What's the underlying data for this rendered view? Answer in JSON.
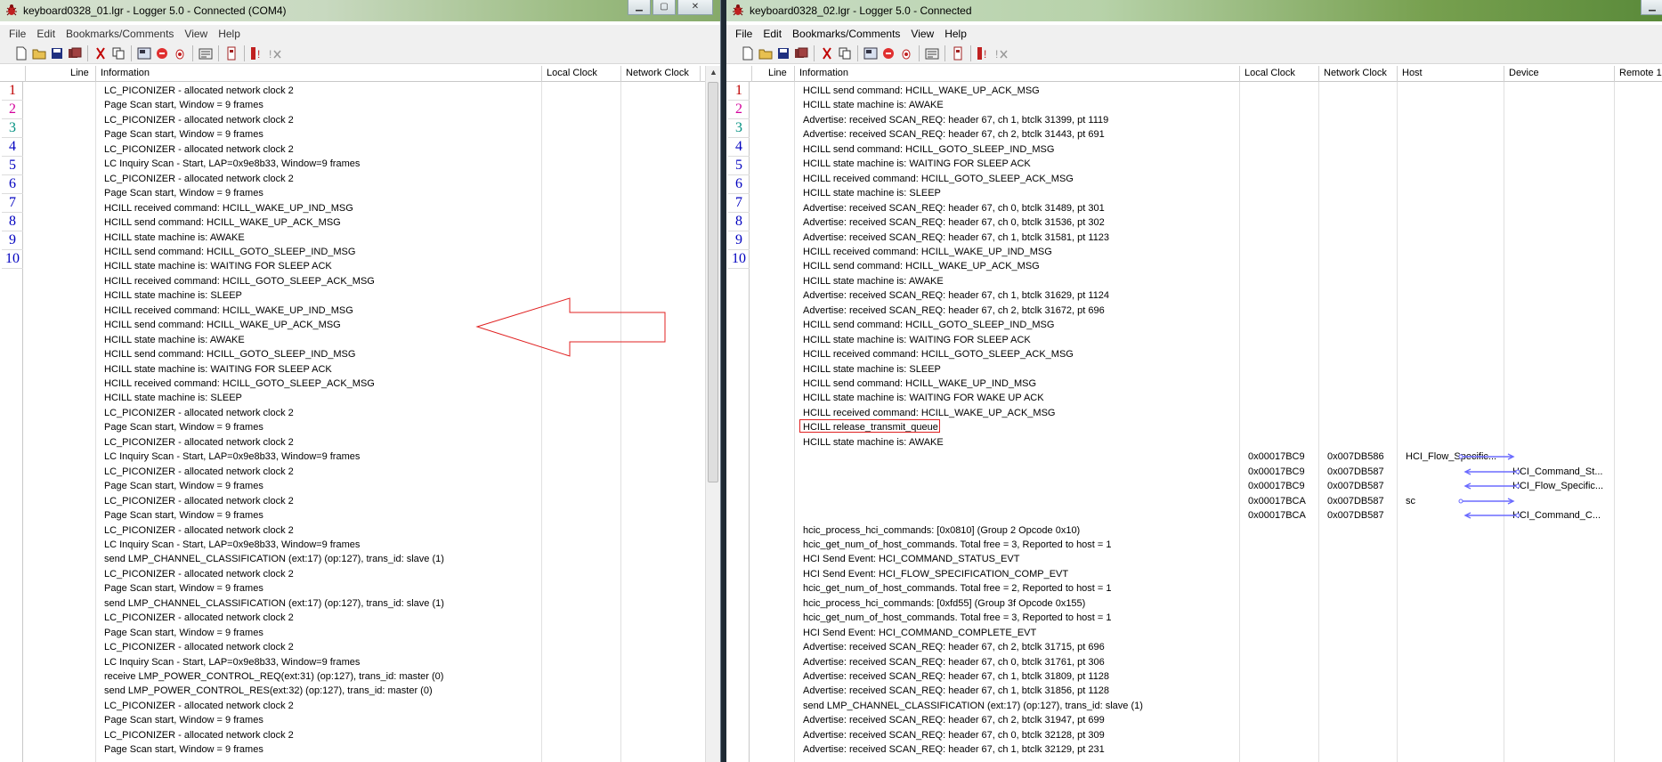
{
  "colors": {
    "bookmark_red": "#c00000",
    "bookmark_magenta": "#d4009c",
    "bookmark_teal": "#009080",
    "bookmark_blue": "#0000c0",
    "highlight": "#e02020",
    "flow_arrow": "#6b6bff"
  },
  "win1": {
    "title": "keyboard0328_01.lgr - Logger 5.0 - Connected  (COM4)",
    "menu": [
      "File",
      "Edit",
      "Bookmarks/Comments",
      "View",
      "Help"
    ],
    "columns": {
      "line": "Line",
      "info": "Information",
      "local": "Local Clock",
      "network": "Network Clock"
    },
    "bookmarks": [
      "1",
      "2",
      "3",
      "4",
      "5",
      "6",
      "7",
      "8",
      "9",
      "10"
    ],
    "rows": [
      "LC_PICONIZER - allocated network clock 2",
      "Page Scan start, Window = 9 frames",
      "LC_PICONIZER - allocated network clock 2",
      "Page Scan start, Window = 9 frames",
      "LC_PICONIZER - allocated network clock 2",
      "LC Inquiry Scan - Start, LAP=0x9e8b33, Window=9 frames",
      "LC_PICONIZER - allocated network clock 2",
      "Page Scan start, Window = 9 frames",
      "HCILL received command: HCILL_WAKE_UP_IND_MSG",
      "HCILL send command: HCILL_WAKE_UP_ACK_MSG",
      "HCILL state machine is: AWAKE",
      "HCILL send command: HCILL_GOTO_SLEEP_IND_MSG",
      "HCILL state machine is: WAITING FOR SLEEP ACK",
      "HCILL received command: HCILL_GOTO_SLEEP_ACK_MSG",
      "HCILL state machine is: SLEEP",
      "HCILL received command: HCILL_WAKE_UP_IND_MSG",
      "HCILL send command: HCILL_WAKE_UP_ACK_MSG",
      "HCILL state machine is: AWAKE",
      "HCILL send command: HCILL_GOTO_SLEEP_IND_MSG",
      "HCILL state machine is: WAITING FOR SLEEP ACK",
      "HCILL received command: HCILL_GOTO_SLEEP_ACK_MSG",
      "HCILL state machine is: SLEEP",
      "LC_PICONIZER - allocated network clock 2",
      "Page Scan start, Window = 9 frames",
      "LC_PICONIZER - allocated network clock 2",
      "LC Inquiry Scan - Start, LAP=0x9e8b33, Window=9 frames",
      "LC_PICONIZER - allocated network clock 2",
      "Page Scan start, Window = 9 frames",
      "LC_PICONIZER - allocated network clock 2",
      "Page Scan start, Window = 9 frames",
      "LC_PICONIZER - allocated network clock 2",
      "LC Inquiry Scan - Start, LAP=0x9e8b33, Window=9 frames",
      "send LMP_CHANNEL_CLASSIFICATION (ext:17) (op:127), trans_id: slave (1)",
      "LC_PICONIZER - allocated network clock 2",
      "Page Scan start, Window = 9 frames",
      "send LMP_CHANNEL_CLASSIFICATION (ext:17) (op:127), trans_id: slave (1)",
      "LC_PICONIZER - allocated network clock 2",
      "Page Scan start, Window = 9 frames",
      "LC_PICONIZER - allocated network clock 2",
      "LC Inquiry Scan - Start, LAP=0x9e8b33, Window=9 frames",
      "receive LMP_POWER_CONTROL_REQ(ext:31) (op:127), trans_id: master (0)",
      "send LMP_POWER_CONTROL_RES(ext:32) (op:127), trans_id: master (0)",
      "LC_PICONIZER - allocated network clock 2",
      "Page Scan start, Window = 9 frames",
      "LC_PICONIZER - allocated network clock 2",
      "Page Scan start, Window = 9 frames"
    ]
  },
  "win2": {
    "title": "keyboard0328_02.lgr - Logger 5.0 - Connected",
    "menu": [
      "File",
      "Edit",
      "Bookmarks/Comments",
      "View",
      "Help"
    ],
    "columns": {
      "line": "Line",
      "info": "Information",
      "local": "Local Clock",
      "network": "Network Clock",
      "host": "Host",
      "device": "Device",
      "remote": "Remote 1"
    },
    "bookmarks": [
      "1",
      "2",
      "3",
      "4",
      "5",
      "6",
      "7",
      "8",
      "9",
      "10"
    ],
    "highlighted_row": "HCILL release_transmit_queue",
    "rows": [
      {
        "info": "HCILL send command: HCILL_WAKE_UP_ACK_MSG"
      },
      {
        "info": "HCILL state machine is: AWAKE"
      },
      {
        "info": "Advertise: received SCAN_REQ: header 67, ch 1, btclk 31399, pt 1119"
      },
      {
        "info": "Advertise: received SCAN_REQ: header 67, ch 2, btclk 31443, pt 691"
      },
      {
        "info": "HCILL send command: HCILL_GOTO_SLEEP_IND_MSG"
      },
      {
        "info": "HCILL state machine is: WAITING FOR SLEEP ACK"
      },
      {
        "info": "HCILL received command: HCILL_GOTO_SLEEP_ACK_MSG"
      },
      {
        "info": "HCILL state machine is: SLEEP"
      },
      {
        "info": "Advertise: received SCAN_REQ: header 67, ch 0, btclk 31489, pt 301"
      },
      {
        "info": "Advertise: received SCAN_REQ: header 67, ch 0, btclk 31536, pt 302"
      },
      {
        "info": "Advertise: received SCAN_REQ: header 67, ch 1, btclk 31581, pt 1123"
      },
      {
        "info": "HCILL received command: HCILL_WAKE_UP_IND_MSG"
      },
      {
        "info": "HCILL send command: HCILL_WAKE_UP_ACK_MSG"
      },
      {
        "info": "HCILL state machine is: AWAKE"
      },
      {
        "info": "Advertise: received SCAN_REQ: header 67, ch 1, btclk 31629, pt 1124"
      },
      {
        "info": "Advertise: received SCAN_REQ: header 67, ch 2, btclk 31672, pt 696"
      },
      {
        "info": "HCILL send command: HCILL_GOTO_SLEEP_IND_MSG"
      },
      {
        "info": "HCILL state machine is: WAITING FOR SLEEP ACK"
      },
      {
        "info": "HCILL received command: HCILL_GOTO_SLEEP_ACK_MSG"
      },
      {
        "info": "HCILL state machine is: SLEEP"
      },
      {
        "info": "HCILL send command: HCILL_WAKE_UP_IND_MSG"
      },
      {
        "info": "HCILL state machine is: WAITING FOR WAKE UP ACK"
      },
      {
        "info": "HCILL received command: HCILL_WAKE_UP_ACK_MSG"
      },
      {
        "info": "HCILL release_transmit_queue"
      },
      {
        "info": "HCILL state machine is: AWAKE"
      },
      {
        "info": "",
        "local": "0x00017BC9",
        "network": "0x007DB586",
        "host": "HCI_Flow_Specific...",
        "device": "",
        "dir": "right"
      },
      {
        "info": "",
        "local": "0x00017BC9",
        "network": "0x007DB587",
        "host": "",
        "device": "HCI_Command_St...",
        "dir": "left"
      },
      {
        "info": "",
        "local": "0x00017BC9",
        "network": "0x007DB587",
        "host": "",
        "device": "HCI_Flow_Specific...",
        "dir": "left"
      },
      {
        "info": "",
        "local": "0x00017BCA",
        "network": "0x007DB587",
        "host": "sc",
        "device": "",
        "dir": "right"
      },
      {
        "info": "",
        "local": "0x00017BCA",
        "network": "0x007DB587",
        "host": "",
        "device": "HCI_Command_C...",
        "dir": "left"
      },
      {
        "info": "hcic_process_hci_commands: [0x0810] (Group 2 Opcode 0x10)"
      },
      {
        "info": "hcic_get_num_of_host_commands. Total free = 3, Reported to host = 1"
      },
      {
        "info": "HCI Send Event: HCI_COMMAND_STATUS_EVT"
      },
      {
        "info": "HCI Send Event: HCI_FLOW_SPECIFICATION_COMP_EVT"
      },
      {
        "info": "hcic_get_num_of_host_commands. Total free = 2, Reported to host = 1"
      },
      {
        "info": "hcic_process_hci_commands: [0xfd55] (Group 3f Opcode 0x155)"
      },
      {
        "info": "hcic_get_num_of_host_commands. Total free = 3, Reported to host = 1"
      },
      {
        "info": "HCI Send Event: HCI_COMMAND_COMPLETE_EVT"
      },
      {
        "info": "Advertise: received SCAN_REQ: header 67, ch 2, btclk 31715, pt 696"
      },
      {
        "info": "Advertise: received SCAN_REQ: header 67, ch 0, btclk 31761, pt 306"
      },
      {
        "info": "Advertise: received SCAN_REQ: header 67, ch 1, btclk 31809, pt 1128"
      },
      {
        "info": "Advertise: received SCAN_REQ: header 67, ch 1, btclk 31856, pt 1128"
      },
      {
        "info": "send LMP_CHANNEL_CLASSIFICATION (ext:17) (op:127), trans_id: slave (1)"
      },
      {
        "info": "Advertise: received SCAN_REQ: header 67, ch 2, btclk 31947, pt 699"
      },
      {
        "info": "Advertise: received SCAN_REQ: header 67, ch 0, btclk 32128, pt 309"
      },
      {
        "info": "Advertise: received SCAN_REQ: header 67, ch 1, btclk 32129, pt 231"
      }
    ]
  }
}
